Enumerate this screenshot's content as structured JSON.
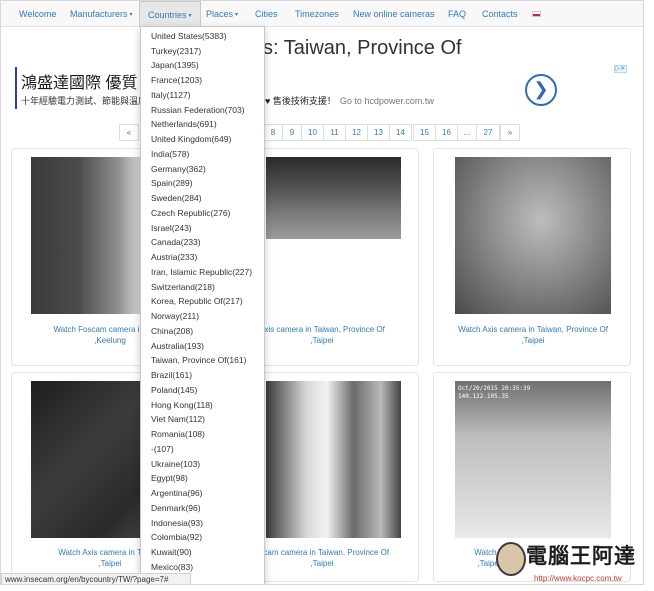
{
  "navbar": {
    "items": [
      {
        "label": "Welcome"
      },
      {
        "label": "Manufacturers",
        "caret": "▾"
      },
      {
        "label": "Countries",
        "caret": "▾",
        "active": true
      },
      {
        "label": "Places",
        "caret": "▾"
      },
      {
        "label": "Cities"
      },
      {
        "label": "Timezones"
      },
      {
        "label": "New online cameras"
      },
      {
        "label": "FAQ"
      },
      {
        "label": "Contacts"
      }
    ],
    "flag_colors": [
      "#ffffff",
      "#d4213d"
    ]
  },
  "page_title": "s: Taiwan, Province Of",
  "ad": {
    "title": "鴻盛達國際 優質",
    "subtitle": "十年經驗電力測試、節能與溫度",
    "subtitle2": "♥ 售後技術支援！",
    "url": "Go to hcdpower.com.tw",
    "go_icon": "❯",
    "badge": "▷✕"
  },
  "pagination": [
    "«",
    "8",
    "9",
    "10",
    "11",
    "12",
    "13",
    "14",
    "15",
    "16",
    "...",
    "27",
    "»"
  ],
  "cameras": [
    {
      "caption1": "Watch Foscam camera in Taiwa",
      "caption2": ",Keelung"
    },
    {
      "caption1": "Axis camera in Taiwan, Province Of",
      "caption2": ",Taipei"
    },
    {
      "caption1": "Watch Axis camera in Taiwan, Province Of",
      "caption2": ",Taipei"
    },
    {
      "caption1": "Watch Axis camera in Taiwan",
      "caption2": ",Taipei"
    },
    {
      "caption1": "oscam camera in Taiwan, Province Of",
      "caption2": ",Taipei"
    },
    {
      "caption1": "Watch F",
      "caption2": ",Taipei"
    }
  ],
  "cam_stamps": [
    "Oct/20/2015 20:35:39",
    "140.122.105.35"
  ],
  "countries": [
    "United States(5383)",
    "Turkey(2317)",
    "Japan(1395)",
    "France(1203)",
    "Italy(1127)",
    "Russian Federation(703)",
    "Netherlands(691)",
    "United Kingdom(649)",
    "India(578)",
    "Germany(362)",
    "Spain(289)",
    "Sweden(284)",
    "Czech Republic(276)",
    "Israel(243)",
    "Canada(233)",
    "Austria(233)",
    "Iran, Islamic Republic(227)",
    "Switzerland(218)",
    "Korea, Republic Of(217)",
    "Norway(211)",
    "China(208)",
    "Australia(193)",
    "Taiwan, Province Of(161)",
    "Brazil(161)",
    "Poland(145)",
    "Hong Kong(118)",
    "Viet Nam(112)",
    "Romania(108)",
    "-(107)",
    "Ukraine(103)",
    "Egypt(98)",
    "Argentina(96)",
    "Denmark(96)",
    "Indonesia(93)",
    "Colombia(92)",
    "Kuwait(90)",
    "Mexico(83)"
  ],
  "statusbar": "www.insecam.org/en/bycountry/TW/?page=7#",
  "watermark": {
    "text": "電腦王阿達",
    "url": "http://www.kocpc.com.tw"
  }
}
